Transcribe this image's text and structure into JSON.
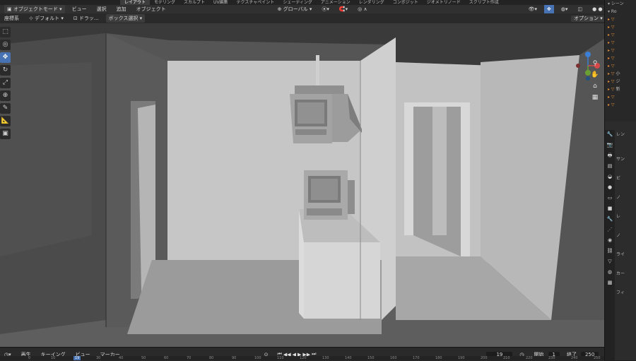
{
  "workspace_tabs": [
    "レイアウト",
    "モデリング",
    "スカルプト",
    "UV編集",
    "テクスチャペイント",
    "シェーディング",
    "アニメーション",
    "レンダリング",
    "コンポジット",
    "ジオメトリノード",
    "スクリプト作成"
  ],
  "header": {
    "mode": "オブジェクトモード",
    "menus": [
      "ビュー",
      "選択",
      "追加",
      "オブジェクト"
    ],
    "orientation": "グローバル"
  },
  "header2": {
    "label_left": "座標系",
    "orientation": "デフォルト",
    "drag": "ドラッ...",
    "select": "ボックス選択",
    "options": "オプション"
  },
  "tools": [
    "select-box",
    "cursor",
    "move",
    "rotate",
    "scale",
    "transform",
    "annotate",
    "measure",
    "add-cube"
  ],
  "gizmo": {
    "x": "X",
    "y": "Y",
    "z": "Z"
  },
  "outliner": {
    "rows": [
      "シーン",
      "Ro",
      "",
      "",
      "",
      "",
      "",
      "",
      "",
      "小",
      "ジ",
      "新",
      "",
      ""
    ]
  },
  "properties": {
    "rows": [
      "レン",
      "サン",
      "ビ",
      "ノ",
      "レ",
      "ノ",
      "ライ",
      "カー",
      "フィ"
    ]
  },
  "timeline": {
    "menus": [
      "再生",
      "キーイング",
      "ビュー",
      "マーカー"
    ],
    "current_frame": "19",
    "start_label": "開始",
    "start": "1",
    "end_label": "終了",
    "end": "250",
    "ruler": [
      "0",
      "10",
      "19",
      "30",
      "40",
      "50",
      "60",
      "70",
      "80",
      "90",
      "100",
      "110",
      "120",
      "130",
      "140",
      "150",
      "160",
      "170",
      "180",
      "190",
      "200",
      "210",
      "220",
      "230",
      "240",
      "250"
    ]
  },
  "colors": {
    "accent": "#4772b3",
    "viewport_bg": "#555555",
    "wall_light": "#c6c6c6"
  }
}
